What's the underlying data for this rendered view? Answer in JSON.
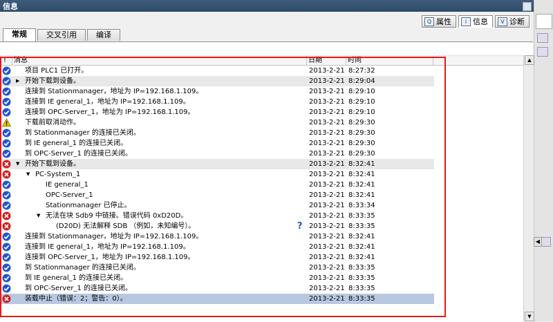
{
  "window": {
    "title": "信息"
  },
  "inspector_tabs": [
    {
      "label": "属性",
      "icon": "properties-icon",
      "glyph": "Q",
      "active": false
    },
    {
      "label": "信息",
      "icon": "info-icon",
      "glyph": "i",
      "active": true
    },
    {
      "label": "诊断",
      "icon": "diagnostics-icon",
      "glyph": "V",
      "active": false
    }
  ],
  "sub_tabs": [
    {
      "label": "常规",
      "active": true
    },
    {
      "label": "交叉引用",
      "active": false
    },
    {
      "label": "编译",
      "active": false
    }
  ],
  "columns": {
    "bang": "!",
    "message": "消息",
    "date": "日期",
    "time": "时间"
  },
  "colors": {
    "ok": "#2255cc",
    "error": "#cc2222",
    "warning": "#f0c000",
    "highlight": "#e81818"
  },
  "rows": [
    {
      "status": "ok",
      "indent": 0,
      "expander": "",
      "message": "项目 PLC1 已打开。",
      "date": "2013-2-21",
      "time": "8:27:32"
    },
    {
      "status": "ok",
      "indent": 0,
      "expander": "▶",
      "message": "开始下载到设备。",
      "date": "2013-2-21",
      "time": "8:29:04",
      "shade": true
    },
    {
      "status": "ok",
      "indent": 0,
      "expander": "",
      "message": "连接到 Stationmanager，地址为 IP=192.168.1.109。",
      "date": "2013-2-21",
      "time": "8:29:10"
    },
    {
      "status": "ok",
      "indent": 0,
      "expander": "",
      "message": "连接到 IE general_1，地址为 IP=192.168.1.109。",
      "date": "2013-2-21",
      "time": "8:29:10"
    },
    {
      "status": "ok",
      "indent": 0,
      "expander": "",
      "message": "连接到 OPC-Server_1，地址为 IP=192.168.1.109。",
      "date": "2013-2-21",
      "time": "8:29:10"
    },
    {
      "status": "warning",
      "indent": 0,
      "expander": "",
      "message": "下载前取消动作。",
      "date": "2013-2-21",
      "time": "8:29:30"
    },
    {
      "status": "ok",
      "indent": 0,
      "expander": "",
      "message": "到 Stationmanager 的连接已关闭。",
      "date": "2013-2-21",
      "time": "8:29:30"
    },
    {
      "status": "ok",
      "indent": 0,
      "expander": "",
      "message": "到 IE general_1 的连接已关闭。",
      "date": "2013-2-21",
      "time": "8:29:30"
    },
    {
      "status": "ok",
      "indent": 0,
      "expander": "",
      "message": "到 OPC-Server_1 的连接已关闭。",
      "date": "2013-2-21",
      "time": "8:29:30"
    },
    {
      "status": "error",
      "indent": 0,
      "expander": "▼",
      "message": "开始下载到设备。",
      "date": "2013-2-21",
      "time": "8:32:41",
      "shade": true
    },
    {
      "status": "error",
      "indent": 1,
      "expander": "▼",
      "message": "PC-System_1",
      "date": "2013-2-21",
      "time": "8:32:41"
    },
    {
      "status": "ok",
      "indent": 2,
      "expander": "",
      "message": "IE general_1",
      "date": "2013-2-21",
      "time": "8:32:41"
    },
    {
      "status": "ok",
      "indent": 2,
      "expander": "",
      "message": "OPC-Server_1",
      "date": "2013-2-21",
      "time": "8:32:41"
    },
    {
      "status": "ok",
      "indent": 2,
      "expander": "",
      "message": "Stationmanager 已停止。",
      "date": "2013-2-21",
      "time": "8:33:34"
    },
    {
      "status": "error",
      "indent": 2,
      "expander": "▼",
      "message": "无法在块 Sdb9 中链接。错误代码 0xD20D。",
      "date": "2013-2-21",
      "time": "8:33:35"
    },
    {
      "status": "error",
      "indent": 3,
      "expander": "",
      "message": "(D20D) 无法解释 SDB （例如，未知编号）。",
      "date": "2013-2-21",
      "time": "8:33:35",
      "help": "?"
    },
    {
      "status": "ok",
      "indent": 0,
      "expander": "",
      "message": "连接到 Stationmanager，地址为 IP=192.168.1.109。",
      "date": "2013-2-21",
      "time": "8:32:41"
    },
    {
      "status": "ok",
      "indent": 0,
      "expander": "",
      "message": "连接到 IE general_1，地址为 IP=192.168.1.109。",
      "date": "2013-2-21",
      "time": "8:32:41"
    },
    {
      "status": "ok",
      "indent": 0,
      "expander": "",
      "message": "连接到 OPC-Server_1，地址为 IP=192.168.1.109。",
      "date": "2013-2-21",
      "time": "8:32:41"
    },
    {
      "status": "ok",
      "indent": 0,
      "expander": "",
      "message": "到 Stationmanager 的连接已关闭。",
      "date": "2013-2-21",
      "time": "8:33:35"
    },
    {
      "status": "ok",
      "indent": 0,
      "expander": "",
      "message": "到 IE general_1 的连接已关闭。",
      "date": "2013-2-21",
      "time": "8:33:35"
    },
    {
      "status": "ok",
      "indent": 0,
      "expander": "",
      "message": "到 OPC-Server_1 的连接已关闭。",
      "date": "2013-2-21",
      "time": "8:33:35"
    },
    {
      "status": "error",
      "indent": 0,
      "expander": "",
      "message": "装载中止（错误：2；警告：0）。",
      "date": "2013-2-21",
      "time": "8:33:35",
      "selected": true
    }
  ]
}
